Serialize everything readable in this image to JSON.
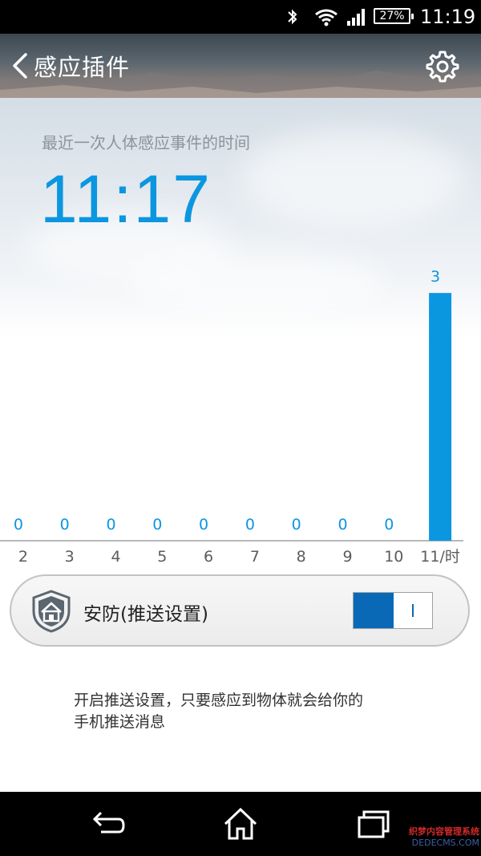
{
  "status_bar": {
    "battery": "27%",
    "time": "11:19",
    "icons": [
      "bluetooth-icon",
      "wifi-icon",
      "signal-icon",
      "battery-icon"
    ]
  },
  "header": {
    "title": "感应插件",
    "back_icon": "chevron-left-icon",
    "settings_icon": "gear-icon"
  },
  "hero": {
    "subtitle": "最近一次人体感应事件的时间",
    "last_time": "11:17"
  },
  "chart_data": {
    "type": "bar",
    "categories": [
      "2",
      "3",
      "4",
      "5",
      "6",
      "7",
      "8",
      "9",
      "10",
      "11/时"
    ],
    "values": [
      0,
      0,
      0,
      0,
      0,
      0,
      0,
      0,
      0,
      3
    ],
    "title": "",
    "xlabel": "",
    "ylabel": "",
    "ylim": [
      0,
      3.4
    ],
    "bar_color": "#0b96e0",
    "label_color": "#0b96e0",
    "axis_color": "#a0a0a0",
    "grid": false
  },
  "security": {
    "label": "安防(推送设置)",
    "toggle_on": true,
    "toggle_color": "#0a69b6",
    "icon": "shield-home-icon"
  },
  "hint": {
    "line1": "开启推送设置，只要感应到物体就会给你的",
    "line2": "手机推送消息"
  },
  "nav_bar": {
    "icons": [
      "back-icon",
      "home-icon",
      "recent-apps-icon"
    ]
  },
  "watermark": {
    "line1": "织梦内容管理系统",
    "line2": "DEDECMS.COM"
  },
  "colors": {
    "accent": "#0b96e0",
    "status_bar": "#000000",
    "nav_bar": "#000000"
  }
}
